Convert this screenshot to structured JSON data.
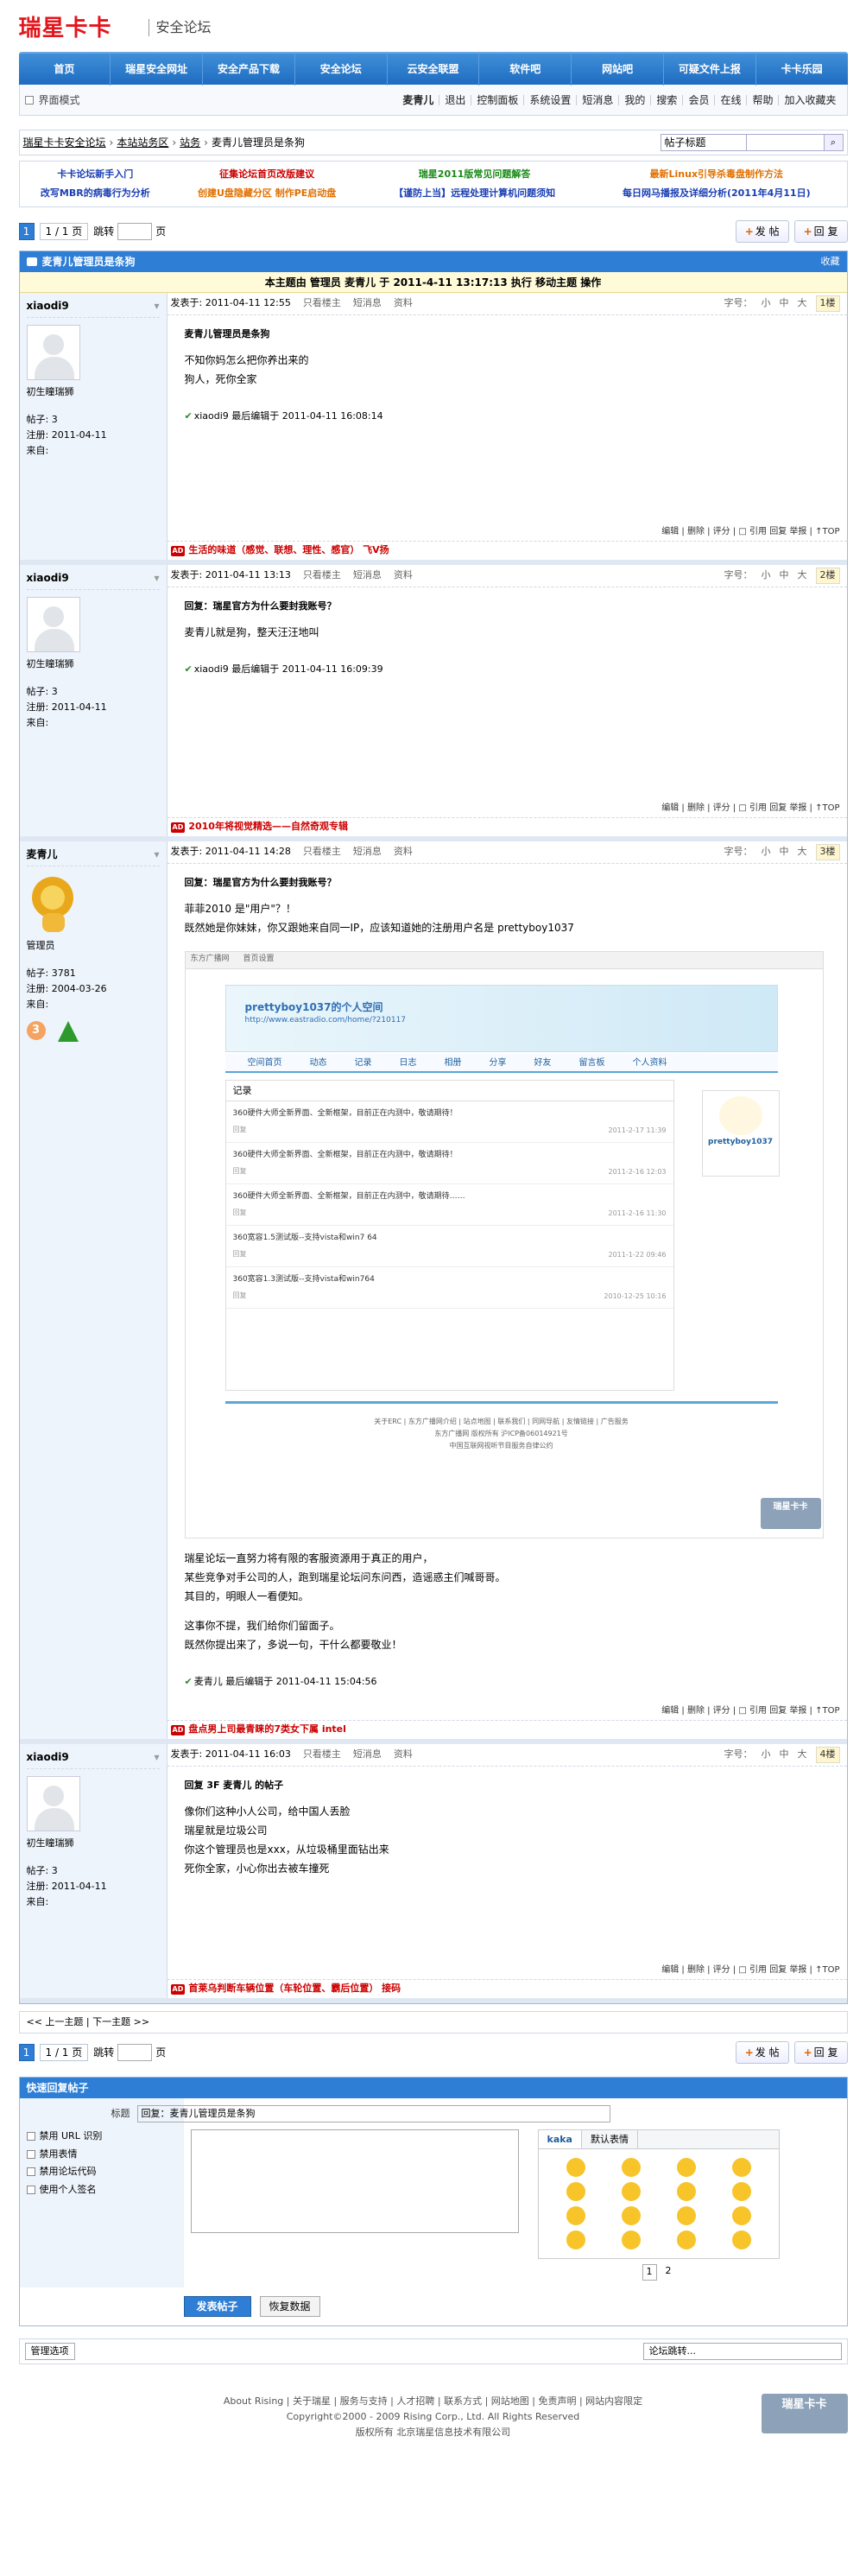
{
  "header": {
    "logo": "瑞星卡卡",
    "subtitle": "安全论坛"
  },
  "nav": [
    "首页",
    "瑞星安全网址",
    "安全产品下载",
    "安全论坛",
    "云安全联盟",
    "软件吧",
    "网站吧",
    "可疑文件上报",
    "卡卡乐园"
  ],
  "userbar": {
    "mode": "界面模式",
    "username": "麦青儿",
    "logout": "退出",
    "links": [
      "控制面板",
      "系统设置",
      "短消息",
      "我的",
      "搜索",
      "会员",
      "在线",
      "帮助",
      "加入收藏夹"
    ]
  },
  "breadcrumb": {
    "items": [
      "瑞星卡卡安全论坛",
      "本站站务区",
      "站务",
      "麦青儿管理员是条狗"
    ],
    "search_select": "帖子标题"
  },
  "announce": [
    {
      "text": "卡卡论坛新手入门",
      "color": "#1a3fb3"
    },
    {
      "text": "征集论坛首页改版建议",
      "color": "#c00"
    },
    {
      "text": "瑞星2011版常见问题解答",
      "color": "#1a8a1a"
    },
    {
      "text": "最新Linux引导杀毒盘制作方法",
      "color": "#e07000"
    },
    {
      "text": "改写MBR的病毒行为分析",
      "color": "#1a3fb3"
    },
    {
      "text": "创建U盘隐藏分区 制作PE启动盘",
      "color": "#e07000"
    },
    {
      "text": "【谨防上当】远程处理计算机问题须知",
      "color": "#1a3fb3"
    },
    {
      "text": "每日网马播报及详细分析(2011年4月11日)",
      "color": "#1a3fb3"
    }
  ],
  "pager": {
    "current": "1",
    "text": "1 / 1 页",
    "jump": "跳转",
    "page": "页",
    "post": "发 帖",
    "reply": "回 复"
  },
  "thread": {
    "title": "麦青儿管理员是条狗",
    "collect": "收藏",
    "notice": "本主题由 管理员 麦青儿 于 2011-4-11 13:17:13 执行 移动主题 操作"
  },
  "posts": [
    {
      "author": "xiaodi9",
      "rank": "初生瞳瑞狮",
      "posts": "帖子: 3",
      "reg": "注册: 2011-04-11",
      "from": "来自:",
      "time": "发表于: 2011-04-11 12:55",
      "floor": "1楼",
      "title": "麦青儿管理员是条狗",
      "lines": [
        "不知你妈怎么把你养出来的",
        "狗人，死你全家"
      ],
      "edit": "xiaodi9 最后编辑于 2011-04-11 16:08:14",
      "ad": "生活的味道（感觉、联想、理性、感官） 飞Ⅴ扬"
    },
    {
      "author": "xiaodi9",
      "rank": "初生瞳瑞狮",
      "posts": "帖子: 3",
      "reg": "注册: 2011-04-11",
      "from": "来自:",
      "time": "发表于: 2011-04-11 13:13",
      "floor": "2楼",
      "title": "回复：瑞星官方为什么要封我账号？",
      "lines": [
        "麦青儿就是狗，整天汪汪地叫"
      ],
      "edit": "xiaodi9 最后编辑于 2011-04-11 16:09:39",
      "ad": "2010年将视觉精选——自然奇观专辑"
    },
    {
      "author": "麦青儿",
      "rank": "管理员",
      "posts": "帖子: 3781",
      "reg": "注册: 2004-03-26",
      "from": "来自:",
      "time": "发表于: 2011-04-11 14:28",
      "floor": "3楼",
      "title": "回复：瑞星官方为什么要封我账号？",
      "lines": [
        "菲菲2010 是\"用户\"？！",
        "既然她是你妹妹，你又跟她来自同一IP，应该知道她的注册用户名是 prettyboy1037"
      ],
      "lines2": [
        "瑞星论坛一直努力将有限的客服资源用于真正的用户，",
        "某些竞争对手公司的人，跑到瑞星论坛问东问西，造谣惑主们喊哥哥。",
        "其目的，明眼人一看便知。",
        "",
        "这事你不提，我们给你们留面子。",
        "既然你提出来了，多说一句，干什么都要敬业！"
      ],
      "edit": "麦青儿 最后编辑于 2011-04-11 15:04:56",
      "ad": "盘点男上司最青睐的7类女下属 intel"
    },
    {
      "author": "xiaodi9",
      "rank": "初生瞳瑞狮",
      "posts": "帖子: 3",
      "reg": "注册: 2011-04-11",
      "from": "来自:",
      "time": "发表于: 2011-04-11 16:03",
      "floor": "4楼",
      "title": "回复 3F 麦青儿 的帖子",
      "lines": [
        "像你们这种小人公司，给中国人丢脸",
        "瑞星就是垃圾公司",
        "你这个管理员也是xxx，从垃圾桶里面钻出来",
        "死你全家，小心你出去被车撞死"
      ],
      "edit": "",
      "ad": "首莱乌判断车辆位置（车轮位置、霸后位置） 接码"
    }
  ],
  "post_common": {
    "only_author": "只看楼主",
    "pm": "短消息",
    "profile": "资料",
    "fontsize": "字号：",
    "small": "小",
    "mid": "中",
    "big": "大",
    "ops": "编辑 | 删除 | 评分 | □ 引用 回复 举报 | ↑TOP"
  },
  "shot": {
    "site": "东方广播网",
    "nav": "首页设置",
    "title": "prettyboy1037的个人空间",
    "url": "http://www.eastradio.com/home/?210117",
    "tabs": [
      "空间首页",
      "动态",
      "记录",
      "日志",
      "相册",
      "分享",
      "好友",
      "留言板",
      "个人资料"
    ],
    "panel": "记录",
    "items": [
      {
        "t": "360硬件大师全新界面、全新框架，目前正在内测中，敬请期待！",
        "d": "2011-2-17 11:39"
      },
      {
        "t": "360硬件大师全新界面、全新框架，目前正在内测中，敬请期待！",
        "d": "2011-2-16 12:03"
      },
      {
        "t": "360硬件大师全新界面、全新框架，目前正在内测中，敬请期待……",
        "d": "2011-2-16 11:30"
      },
      {
        "t": "360宽容1.5测试版--支持vista和win7 64",
        "d": "2011-1-22 09:46"
      },
      {
        "t": "360宽容1.3测试版--支持vista和win764",
        "d": "2010-12-25 10:16"
      }
    ],
    "prof_name": "prettyboy1037",
    "footer": [
      "关于ERC | 东方广播网介绍 | 站点地图 | 联系我们 | 同网导航 | 友情链接 | 广告服务",
      "东方广播网  版权所有  沪ICP备06014921号",
      "中国互联网视听节目服务自律公约"
    ],
    "watermark": "瑞星卡卡"
  },
  "prevnext": "<< 上一主题 | 下一主题 >>",
  "quickreply": {
    "title": "快速回复帖子",
    "label": "标题",
    "value": "回复：麦青儿管理员是条狗",
    "opts": [
      "禁用 URL 识别",
      "禁用表情",
      "禁用论坛代码",
      "使用个人签名"
    ],
    "tabs": [
      "kaka",
      "默认表情"
    ],
    "pages": [
      "1",
      "2"
    ],
    "submit": "发表帖子",
    "restore": "恢复数据"
  },
  "bottom": {
    "left": "管理选项",
    "right": "论坛跳转..."
  },
  "footer": {
    "links": "About Rising | 关于瑞星 | 服务与支持 | 人才招聘 | 联系方式 | 网站地图 | 免责声明 | 网站内容限定",
    "copy": "Copyright©2000 - 2009 Rising Corp., Ltd.  All Rights Reserved",
    "corp": "版权所有  北京瑞星信息技术有限公司",
    "wm": "瑞星卡卡"
  }
}
